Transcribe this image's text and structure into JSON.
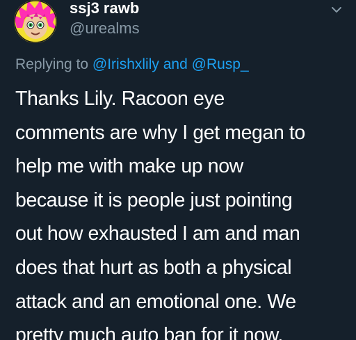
{
  "author": {
    "display_name": "ssj3 rawb",
    "handle": "@urealms"
  },
  "reply_context": {
    "prefix": "Replying to",
    "mention_1": "@Irishxlily",
    "conjunction": "and",
    "mention_2": "@Rusp_"
  },
  "tweet": {
    "lines": [
      "Thanks Lily. Racoon eye",
      "comments are why I get megan to",
      "help me with make up now",
      "because it is people just pointing",
      "out how exhausted I am and man",
      "does that hurt as both a physical",
      "attack and an emotional one. We",
      "pretty much auto ban for it now."
    ]
  },
  "icons": {
    "avatar": "cartoon-avatar-pink-hair",
    "more": "chevron-down-icon"
  },
  "colors": {
    "background": "#15202b",
    "text": "#ffffff",
    "secondary": "#8899a6",
    "accent": "#1da1f2"
  }
}
